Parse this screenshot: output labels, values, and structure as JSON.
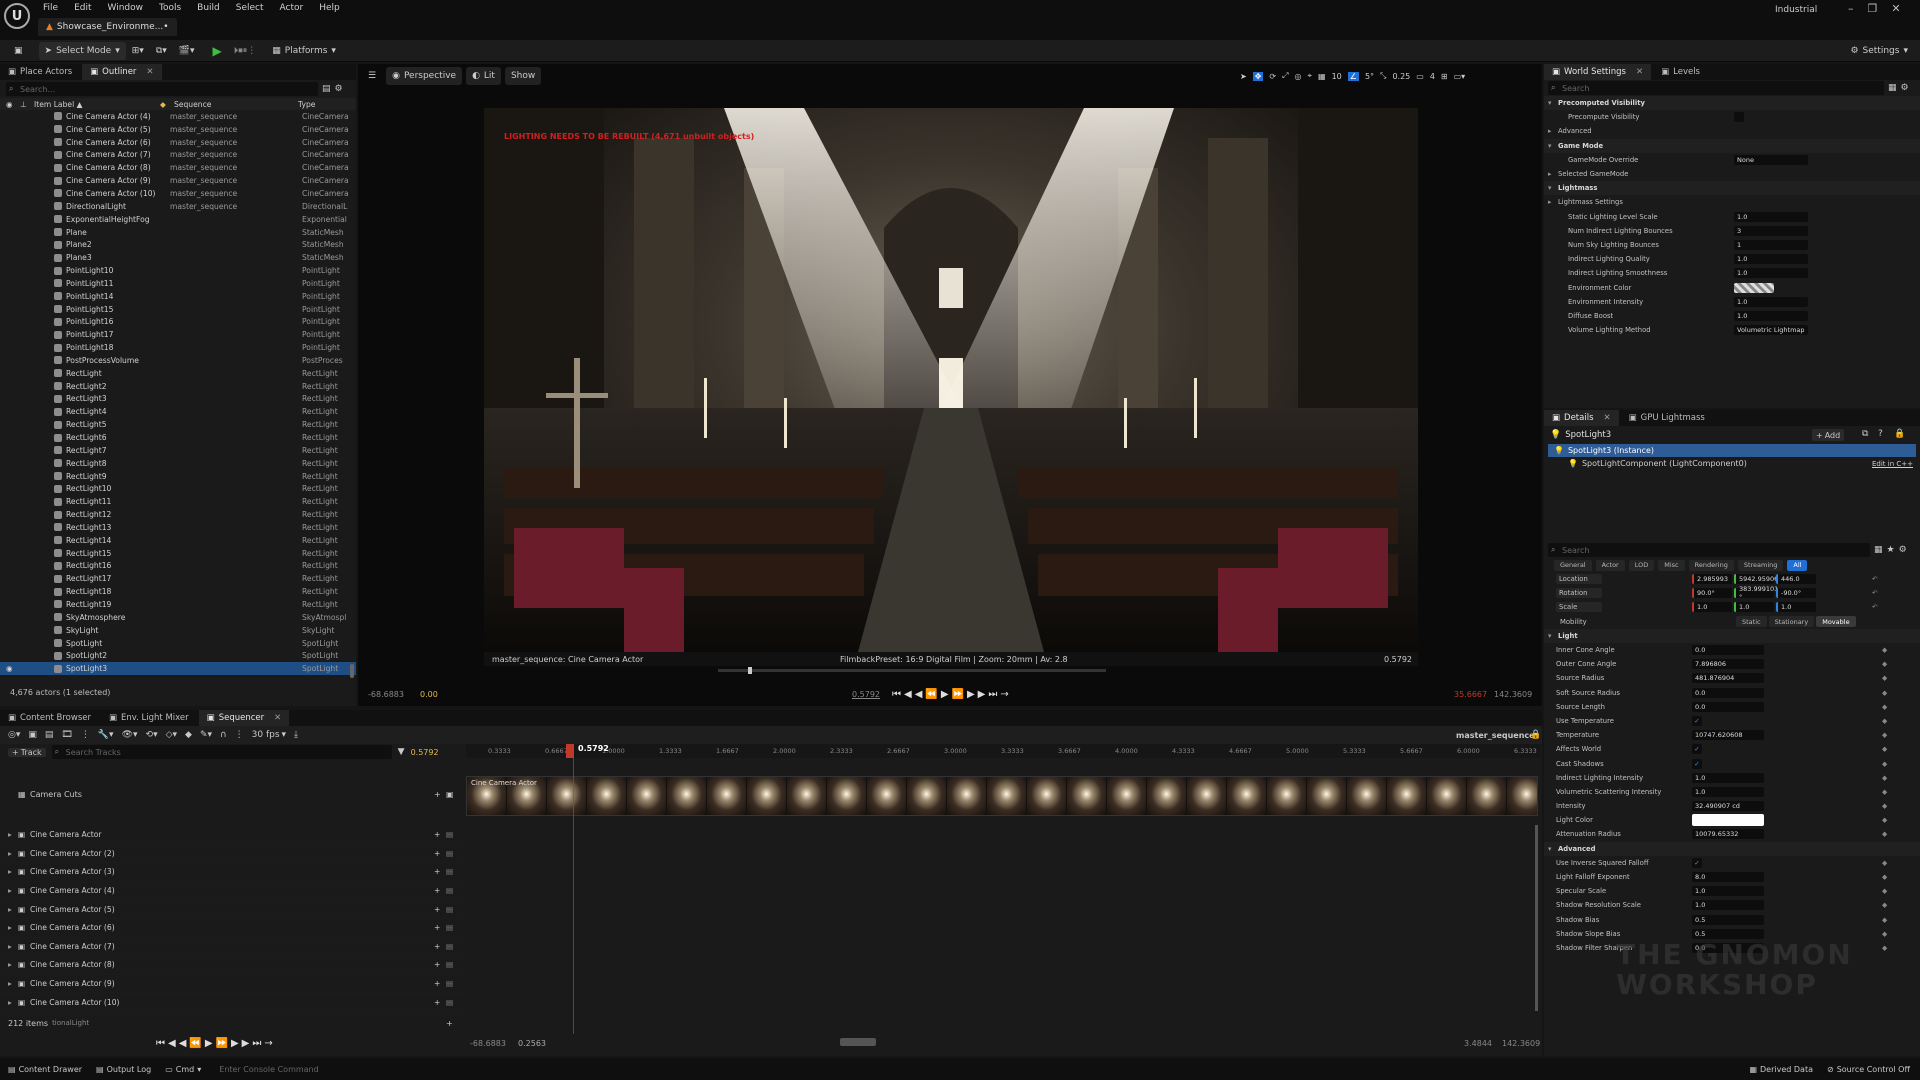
{
  "app": {
    "menu": [
      "File",
      "Edit",
      "Window",
      "Tools",
      "Build",
      "Select",
      "Actor",
      "Help"
    ],
    "project_tab": "Showcase_Environme...•",
    "layout_name": "Industrial"
  },
  "toolbar": {
    "select_mode": "Select Mode",
    "platforms": "Platforms",
    "settings": "Settings"
  },
  "outliner": {
    "tabs": [
      "Place Actors",
      "Outliner"
    ],
    "search_placeholder": "Search...",
    "columns": [
      "Item Label ▲",
      "Sequence",
      "Type"
    ],
    "rows": [
      {
        "name": "Cine Camera Actor (4)",
        "seq": "master_sequence",
        "type": "CineCamera"
      },
      {
        "name": "Cine Camera Actor (5)",
        "seq": "master_sequence",
        "type": "CineCamera"
      },
      {
        "name": "Cine Camera Actor (6)",
        "seq": "master_sequence",
        "type": "CineCamera"
      },
      {
        "name": "Cine Camera Actor (7)",
        "seq": "master_sequence",
        "type": "CineCamera"
      },
      {
        "name": "Cine Camera Actor (8)",
        "seq": "master_sequence",
        "type": "CineCamera"
      },
      {
        "name": "Cine Camera Actor (9)",
        "seq": "master_sequence",
        "type": "CineCamera"
      },
      {
        "name": "Cine Camera Actor (10)",
        "seq": "master_sequence",
        "type": "CineCamera"
      },
      {
        "name": "DirectionalLight",
        "seq": "master_sequence",
        "type": "DirectionalL"
      },
      {
        "name": "ExponentialHeightFog",
        "seq": "",
        "type": "Exponential"
      },
      {
        "name": "Plane",
        "seq": "",
        "type": "StaticMesh"
      },
      {
        "name": "Plane2",
        "seq": "",
        "type": "StaticMesh"
      },
      {
        "name": "Plane3",
        "seq": "",
        "type": "StaticMesh"
      },
      {
        "name": "PointLight10",
        "seq": "",
        "type": "PointLight"
      },
      {
        "name": "PointLight11",
        "seq": "",
        "type": "PointLight"
      },
      {
        "name": "PointLight14",
        "seq": "",
        "type": "PointLight"
      },
      {
        "name": "PointLight15",
        "seq": "",
        "type": "PointLight"
      },
      {
        "name": "PointLight16",
        "seq": "",
        "type": "PointLight"
      },
      {
        "name": "PointLight17",
        "seq": "",
        "type": "PointLight"
      },
      {
        "name": "PointLight18",
        "seq": "",
        "type": "PointLight"
      },
      {
        "name": "PostProcessVolume",
        "seq": "",
        "type": "PostProces"
      },
      {
        "name": "RectLight",
        "seq": "",
        "type": "RectLight"
      },
      {
        "name": "RectLight2",
        "seq": "",
        "type": "RectLight"
      },
      {
        "name": "RectLight3",
        "seq": "",
        "type": "RectLight"
      },
      {
        "name": "RectLight4",
        "seq": "",
        "type": "RectLight"
      },
      {
        "name": "RectLight5",
        "seq": "",
        "type": "RectLight"
      },
      {
        "name": "RectLight6",
        "seq": "",
        "type": "RectLight"
      },
      {
        "name": "RectLight7",
        "seq": "",
        "type": "RectLight"
      },
      {
        "name": "RectLight8",
        "seq": "",
        "type": "RectLight"
      },
      {
        "name": "RectLight9",
        "seq": "",
        "type": "RectLight"
      },
      {
        "name": "RectLight10",
        "seq": "",
        "type": "RectLight"
      },
      {
        "name": "RectLight11",
        "seq": "",
        "type": "RectLight"
      },
      {
        "name": "RectLight12",
        "seq": "",
        "type": "RectLight"
      },
      {
        "name": "RectLight13",
        "seq": "",
        "type": "RectLight"
      },
      {
        "name": "RectLight14",
        "seq": "",
        "type": "RectLight"
      },
      {
        "name": "RectLight15",
        "seq": "",
        "type": "RectLight"
      },
      {
        "name": "RectLight16",
        "seq": "",
        "type": "RectLight"
      },
      {
        "name": "RectLight17",
        "seq": "",
        "type": "RectLight"
      },
      {
        "name": "RectLight18",
        "seq": "",
        "type": "RectLight"
      },
      {
        "name": "RectLight19",
        "seq": "",
        "type": "RectLight"
      },
      {
        "name": "SkyAtmosphere",
        "seq": "",
        "type": "SkyAtmospl"
      },
      {
        "name": "SkyLight",
        "seq": "",
        "type": "SkyLight"
      },
      {
        "name": "SpotLight",
        "seq": "",
        "type": "SpotLight"
      },
      {
        "name": "SpotLight2",
        "seq": "",
        "type": "SpotLight"
      },
      {
        "name": "SpotLight3",
        "seq": "",
        "type": "SpotLight",
        "selected": true
      }
    ],
    "status": "4,676 actors (1 selected)"
  },
  "viewport": {
    "perspective": "Perspective",
    "lit": "Lit",
    "show": "Show",
    "warning": "LIGHTING NEEDS TO BE REBUILT (4,671 unbuilt objects)",
    "overlay_left": "master_sequence: Cine Camera Actor",
    "overlay_center": "FilmbackPreset: 16:9 Digital Film | Zoom: 20mm | Av: 2.8",
    "overlay_right": "0.5792",
    "grid": "10",
    "angle": "5°",
    "scale": "0.25",
    "cam_speed": "4",
    "range_start": "-68.6883",
    "range_in": "0.00",
    "cur_left": "0.5792",
    "range_out_red": "35.6667",
    "range_end": "142.3609"
  },
  "world_settings": {
    "tabs": [
      "World Settings",
      "Levels"
    ],
    "search_placeholder": "Search",
    "rows": [
      {
        "label": "Precomputed Visibility",
        "section": true
      },
      {
        "label": "Precompute Visibility",
        "value": ""
      },
      {
        "label": "Advanced",
        "sub": true
      },
      {
        "label": "Game Mode",
        "section": true
      },
      {
        "label": "GameMode Override",
        "value": "None"
      },
      {
        "label": "Selected GameMode",
        "sub": true
      },
      {
        "label": "Lightmass",
        "section": true
      },
      {
        "label": "Lightmass Settings",
        "sub": true
      },
      {
        "label": "Static Lighting Level Scale",
        "value": "1.0"
      },
      {
        "label": "Num Indirect Lighting Bounces",
        "value": "3"
      },
      {
        "label": "Num Sky Lighting Bounces",
        "value": "1"
      },
      {
        "label": "Indirect Lighting Quality",
        "value": "1.0"
      },
      {
        "label": "Indirect Lighting Smoothness",
        "value": "1.0"
      },
      {
        "label": "Environment Color",
        "value": ""
      },
      {
        "label": "Environment Intensity",
        "value": "1.0"
      },
      {
        "label": "Diffuse Boost",
        "value": "1.0"
      },
      {
        "label": "Volume Lighting Method",
        "value": "Volumetric Lightmap"
      }
    ]
  },
  "details": {
    "tabs": [
      "Details",
      "GPU Lightmass"
    ],
    "actor": "SpotLight3",
    "add": "Add",
    "instance": "SpotLight3 (Instance)",
    "component": "SpotLightComponent (LightComponent0)",
    "edit_cpp": "Edit in C++",
    "search_placeholder": "Search",
    "filters": [
      "General",
      "Actor",
      "LOD",
      "Misc",
      "Rendering",
      "Streaming",
      "All"
    ],
    "transform": [
      {
        "label": "Location",
        "x": "2.985993",
        "y": "5942.95906",
        "z": "446.0"
      },
      {
        "label": "Rotation",
        "x": "90.0°",
        "y": "383.999101 °",
        "z": "-90.0°"
      },
      {
        "label": "Scale",
        "x": "1.0",
        "y": "1.0",
        "z": "1.0"
      }
    ],
    "mobility": {
      "label": "Mobility",
      "options": [
        "Static",
        "Stationary",
        "Movable"
      ]
    },
    "rows": [
      {
        "label": "Light",
        "section": true
      },
      {
        "label": "Inner Cone Angle",
        "value": "0.0"
      },
      {
        "label": "Outer Cone Angle",
        "value": "7.896806"
      },
      {
        "label": "Source Radius",
        "value": "481.876904"
      },
      {
        "label": "Soft Source Radius",
        "value": "0.0"
      },
      {
        "label": "Source Length",
        "value": "0.0"
      },
      {
        "label": "Use Temperature",
        "value": "✓"
      },
      {
        "label": "Temperature",
        "value": "10747.620608"
      },
      {
        "label": "Affects World",
        "value": "✓"
      },
      {
        "label": "Cast Shadows",
        "value": "✓"
      },
      {
        "label": "Indirect Lighting Intensity",
        "value": "1.0"
      },
      {
        "label": "Volumetric Scattering Intensity",
        "value": "1.0"
      },
      {
        "label": "Intensity",
        "value": "32.490907 cd"
      },
      {
        "label": "Light Color",
        "value": ""
      },
      {
        "label": "Attenuation Radius",
        "value": "10079.65332"
      },
      {
        "label": "Advanced",
        "section": true
      },
      {
        "label": "Use Inverse Squared Falloff",
        "value": "✓"
      },
      {
        "label": "Light Falloff Exponent",
        "value": "8.0"
      },
      {
        "label": "Specular Scale",
        "value": "1.0"
      },
      {
        "label": "Shadow Resolution Scale",
        "value": "1.0"
      },
      {
        "label": "Shadow Bias",
        "value": "0.5"
      },
      {
        "label": "Shadow Slope Bias",
        "value": "0.5"
      },
      {
        "label": "Shadow Filter Sharpen",
        "value": "0.0"
      }
    ]
  },
  "sequencer": {
    "tabs": [
      "Content Browser",
      "Env. Light Mixer",
      "Sequencer"
    ],
    "fps": "30 fps",
    "sequence_name": "master_sequence",
    "add_track": "Track",
    "search_placeholder": "Search Tracks",
    "current_time": "0.5792",
    "ruler_labels": [
      "0.3333",
      "0.6667",
      "1.0000",
      "1.3333",
      "1.6667",
      "2.0000",
      "2.3333",
      "2.6667",
      "3.0000",
      "3.3333",
      "3.6667",
      "4.0000",
      "4.3333",
      "4.6667",
      "5.0000",
      "5.3333",
      "5.6667",
      "6.0000",
      "6.3333"
    ],
    "camera_cuts": "Camera Cuts",
    "shot_label": "Cine Camera Actor",
    "tracks": [
      "Cine Camera Actor",
      "Cine Camera Actor (2)",
      "Cine Camera Actor (3)",
      "Cine Camera Actor (4)",
      "Cine Camera Actor (5)",
      "Cine Camera Actor (6)",
      "Cine Camera Actor (7)",
      "Cine Camera Actor (8)",
      "Cine Camera Actor (9)",
      "Cine Camera Actor (10)"
    ],
    "items_count": "212 items",
    "items_suffix": "tionalLight",
    "range_start": "-68.6883",
    "range_cur": "0.2563",
    "range_end_a": "3.4844",
    "range_end_b": "142.3609"
  },
  "statusbar": {
    "content_drawer": "Content Drawer",
    "output_log": "Output Log",
    "cmd": "Cmd",
    "console_placeholder": "Enter Console Command",
    "derived": "Derived Data",
    "source_control": "Source Control Off"
  },
  "colors": {
    "accent": "#1f6fd6",
    "selection": "#1f4e85",
    "warning": "#d21f1f",
    "playhead": "#c0392b"
  }
}
